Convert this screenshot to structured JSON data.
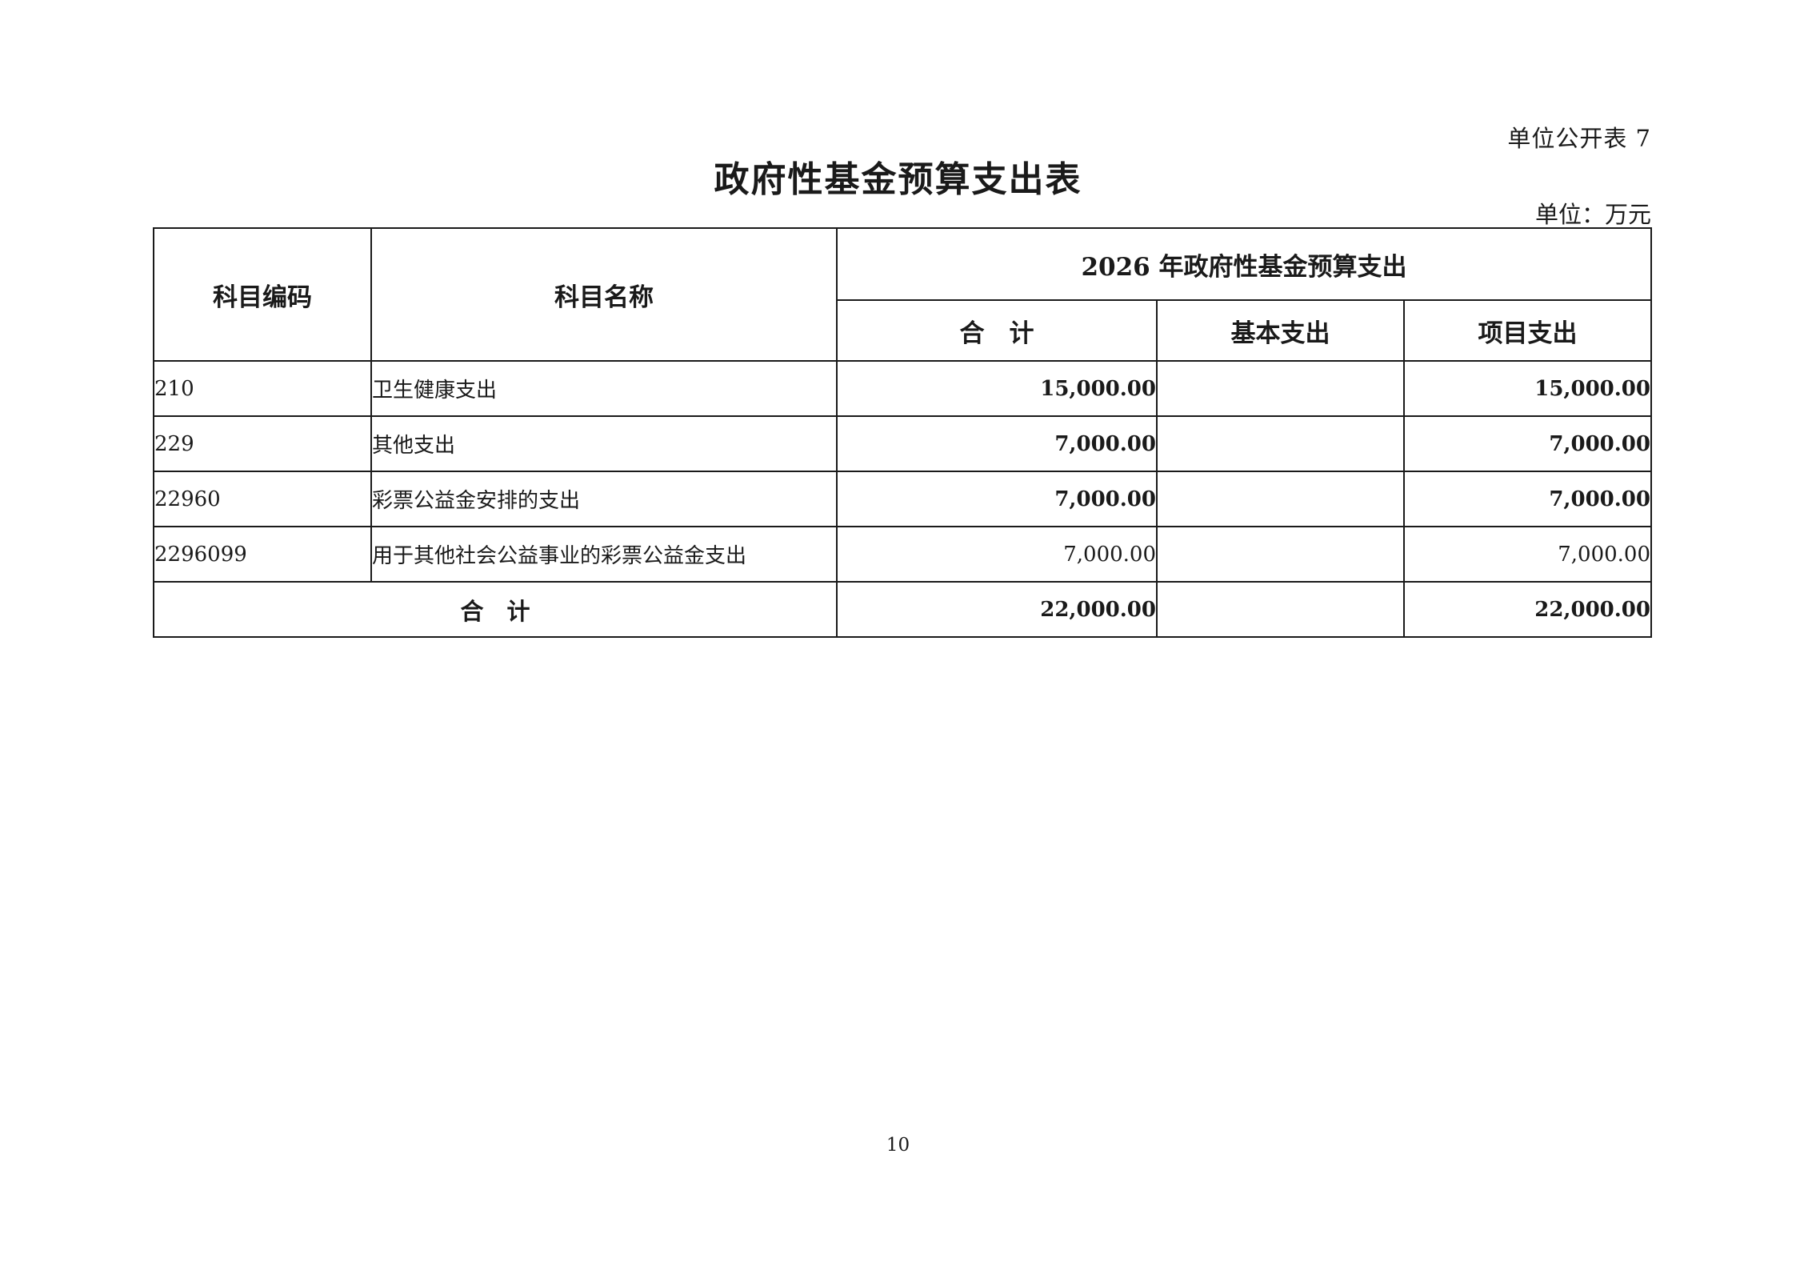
{
  "table_no": "单位公开表 7",
  "title": "政府性基金预算支出表",
  "unit": "单位：万元",
  "headers": {
    "code": "科目编码",
    "name": "科目名称",
    "group": "2026 年政府性基金预算支出",
    "total": "合　计",
    "basic": "基本支出",
    "project": "项目支出"
  },
  "rows": [
    {
      "code": "210",
      "name": "卫生健康支出",
      "total": "15,000.00",
      "basic": "",
      "project": "15,000.00"
    },
    {
      "code": "229",
      "name": "其他支出",
      "total": "7,000.00",
      "basic": "",
      "project": "7,000.00"
    },
    {
      "code": "22960",
      "name": "彩票公益金安排的支出",
      "total": "7,000.00",
      "basic": "",
      "project": "7,000.00"
    },
    {
      "code": "2296099",
      "name": "用于其他社会公益事业的彩票公益金支出",
      "total": "7,000.00",
      "basic": "",
      "project": "7,000.00"
    }
  ],
  "footer": {
    "label": "合　计",
    "total": "22,000.00",
    "basic": "",
    "project": "22,000.00"
  },
  "page_number": "10"
}
